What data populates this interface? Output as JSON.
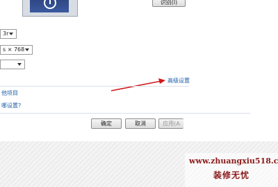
{
  "preview": {
    "identify_button": "识别(I)"
  },
  "settings": {
    "orientation_partial": "3r",
    "resolution_partial": "s × 768",
    "third_select_value": ""
  },
  "links": {
    "advanced_settings": "高级设置",
    "other_items_partial": "他项目",
    "which_settings_partial": "哪设置?"
  },
  "footer_buttons": {
    "ok": "确定",
    "cancel": "取消",
    "apply_partial": "应用(A"
  },
  "watermark": {
    "url": "www.zhuangxiu518.com",
    "brand": "装修无忧"
  },
  "colors": {
    "annotation_arrow": "#d0161b",
    "link": "#1e5ea8",
    "watermark": "#8b1a1a"
  }
}
